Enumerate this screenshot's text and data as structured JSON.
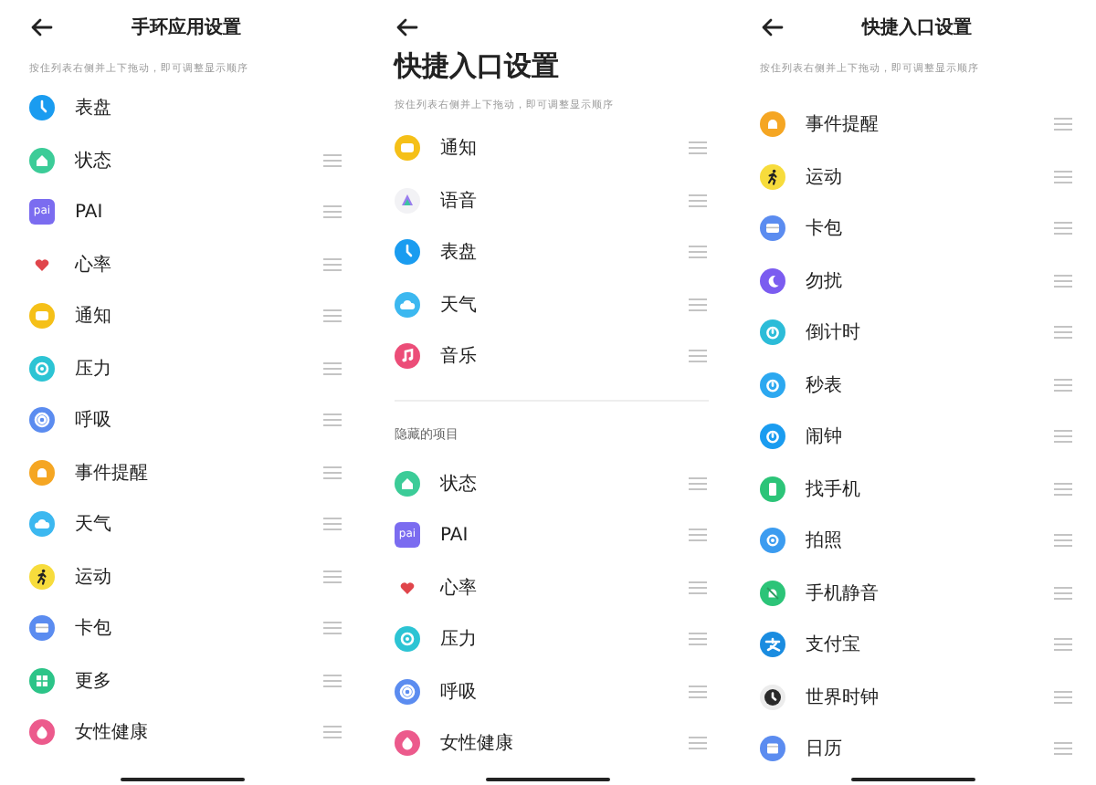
{
  "panels": [
    {
      "header": {
        "kind": "compact",
        "title": "手环应用设置"
      },
      "hint": "按住列表右侧并上下拖动，即可调整显示顺序",
      "sections": [
        {
          "items": [
            {
              "label": "表盘",
              "kind": "clock",
              "color": "#1a9cf0",
              "draggable": false
            },
            {
              "label": "状态",
              "kind": "home",
              "color": "#3ccc98",
              "draggable": true
            },
            {
              "label": "PAI",
              "kind": "pai",
              "icon_text": "pai",
              "color": "#7b6cf0",
              "draggable": true
            },
            {
              "label": "心率",
              "kind": "heart",
              "color": "#e0454b",
              "draggable": true
            },
            {
              "label": "通知",
              "kind": "chat",
              "color": "#f5c018",
              "draggable": true
            },
            {
              "label": "压力",
              "kind": "gauge",
              "color": "#2cc4d4",
              "draggable": true
            },
            {
              "label": "呼吸",
              "kind": "breath",
              "color": "#5b8cf0",
              "draggable": true
            },
            {
              "label": "事件提醒",
              "kind": "bell",
              "color": "#f5a623",
              "draggable": true
            },
            {
              "label": "天气",
              "kind": "cloud",
              "color": "#3cb8f0",
              "draggable": true
            },
            {
              "label": "运动",
              "kind": "run",
              "color": "#f7dc3c",
              "draggable": true
            },
            {
              "label": "卡包",
              "kind": "card",
              "color": "#5b8cf0",
              "draggable": true
            },
            {
              "label": "更多",
              "kind": "grid",
              "color": "#2cc488",
              "draggable": true
            },
            {
              "label": "女性健康",
              "kind": "drop",
              "color": "#ec5a8c",
              "draggable": true
            }
          ]
        }
      ]
    },
    {
      "header": {
        "kind": "large",
        "title": "快捷入口设置"
      },
      "hint": "按住列表右侧并上下拖动，即可调整显示顺序",
      "sections": [
        {
          "items": [
            {
              "label": "通知",
              "kind": "chat",
              "color": "#f5c018",
              "draggable": true
            },
            {
              "label": "语音",
              "kind": "voice",
              "color": "#f2f2f5",
              "draggable": true
            },
            {
              "label": "表盘",
              "kind": "clock",
              "color": "#1a9cf0",
              "draggable": true
            },
            {
              "label": "天气",
              "kind": "cloud",
              "color": "#3cb8f0",
              "draggable": true
            },
            {
              "label": "音乐",
              "kind": "music",
              "color": "#ec4d78",
              "draggable": true
            }
          ]
        },
        {
          "title": "隐藏的项目",
          "items": [
            {
              "label": "状态",
              "kind": "home",
              "color": "#3ccc98",
              "draggable": true
            },
            {
              "label": "PAI",
              "kind": "pai",
              "icon_text": "pai",
              "color": "#7b6cf0",
              "draggable": true
            },
            {
              "label": "心率",
              "kind": "heart",
              "color": "#e0454b",
              "draggable": true
            },
            {
              "label": "压力",
              "kind": "gauge",
              "color": "#2cc4d4",
              "draggable": true
            },
            {
              "label": "呼吸",
              "kind": "breath",
              "color": "#5b8cf0",
              "draggable": true
            },
            {
              "label": "女性健康",
              "kind": "drop",
              "color": "#ec5a8c",
              "draggable": true
            }
          ]
        }
      ]
    },
    {
      "header": {
        "kind": "compact",
        "title": "快捷入口设置"
      },
      "hint": "按住列表右侧并上下拖动，即可调整显示顺序",
      "sections": [
        {
          "items": [
            {
              "label": "事件提醒",
              "kind": "bell",
              "color": "#f5a623",
              "draggable": true
            },
            {
              "label": "运动",
              "kind": "run",
              "color": "#f7dc3c",
              "draggable": true
            },
            {
              "label": "卡包",
              "kind": "card",
              "color": "#5b8cf0",
              "draggable": true
            },
            {
              "label": "勿扰",
              "kind": "moon",
              "color": "#7b5cf0",
              "draggable": true
            },
            {
              "label": "倒计时",
              "kind": "timer",
              "color": "#2cbcd8",
              "draggable": true
            },
            {
              "label": "秒表",
              "kind": "timer",
              "color": "#2ca8f0",
              "draggable": true
            },
            {
              "label": "闹钟",
              "kind": "timer",
              "color": "#1a9cf0",
              "draggable": true
            },
            {
              "label": "找手机",
              "kind": "phone",
              "color": "#2cc478",
              "draggable": true
            },
            {
              "label": "拍照",
              "kind": "camera",
              "color": "#3c9cf0",
              "draggable": true
            },
            {
              "label": "手机静音",
              "kind": "mute",
              "color": "#2cc478",
              "draggable": true
            },
            {
              "label": "支付宝",
              "kind": "alipay",
              "color": "#1a8ce0",
              "draggable": true
            },
            {
              "label": "世界时钟",
              "kind": "worldclock",
              "color": "#2a2a2a",
              "draggable": true
            },
            {
              "label": "日历",
              "kind": "calendar",
              "color": "#5b8cf0",
              "draggable": true
            }
          ]
        }
      ]
    }
  ]
}
